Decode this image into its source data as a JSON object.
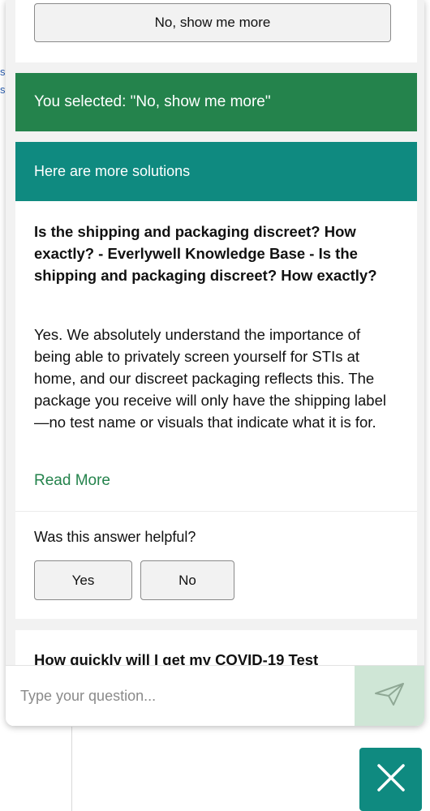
{
  "previous_option": {
    "button_label": "No, show me more"
  },
  "selection": {
    "text": "You selected: \"No, show me more\""
  },
  "answer": {
    "header": "Here are more solutions",
    "title": "Is the shipping and packaging discreet? How exactly? - Everlywell Knowledge Base - Is the shipping and packaging discreet? How exactly?",
    "body": "Yes. We absolutely understand the importance of being able to privately screen yourself for STIs at home, and our discreet packaging reflects this. The package you receive will only have the shipping label—no test name or visuals that indicate what it is for.",
    "read_more": "Read More",
    "feedback": {
      "question": "Was this answer helpful?",
      "yes": "Yes",
      "no": "No"
    }
  },
  "next_answer": {
    "title": "How quickly will I get my COVID-19 Test"
  },
  "composer": {
    "placeholder": "Type your question...",
    "send_icon": "send-icon"
  },
  "close_icon": "close-icon",
  "colors": {
    "green": "#24834c",
    "teal": "#0f8a80",
    "send_bg": "#cfe6d6"
  }
}
